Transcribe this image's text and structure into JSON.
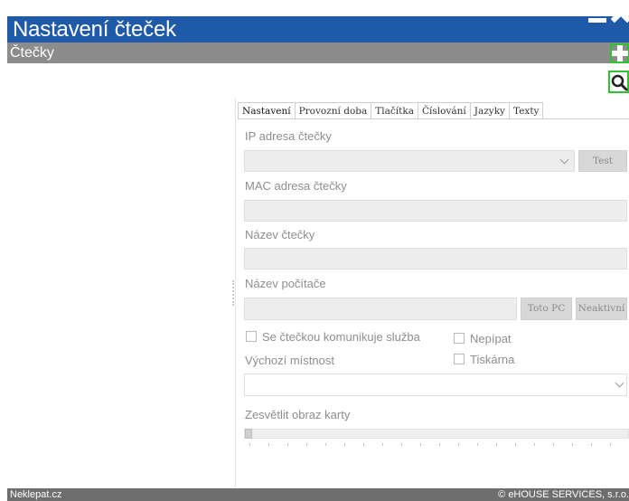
{
  "window": {
    "title": "Nastavení čteček",
    "minimize_icon": "minimize-icon",
    "close_icon": "close-icon"
  },
  "section": {
    "label": "Čtečky",
    "add_icon": "plus-icon",
    "search_icon": "search-icon"
  },
  "tabs": [
    {
      "label": "Nastavení",
      "active": true
    },
    {
      "label": "Provozní doba",
      "active": false
    },
    {
      "label": "Tlačítka",
      "active": false
    },
    {
      "label": "Číslování",
      "active": false
    },
    {
      "label": "Jazyky",
      "active": false
    },
    {
      "label": "Texty",
      "active": false
    }
  ],
  "form": {
    "ip_label": "IP adresa čtečky",
    "ip_value": "",
    "test_button": "Test",
    "mac_label": "MAC adresa čtečky",
    "mac_value": "",
    "name_label": "Název čtečky",
    "name_value": "",
    "pc_label": "Název počítače",
    "pc_value": "",
    "this_pc_button": "Toto PC",
    "inactive_button": "Neaktivní",
    "service_checkbox": {
      "label": "Se čtečkou komunikuje služba",
      "checked": false
    },
    "nepipat_checkbox": {
      "label": "Nepípat",
      "checked": false
    },
    "printer_checkbox": {
      "label": "Tiskárna",
      "checked": false
    },
    "default_room_label": "Výchozí místnost",
    "default_room_value": "",
    "brighten_label": "Zesvětlit obraz karty",
    "brighten_value": 0
  },
  "footer": {
    "left": "Neklepat.cz",
    "right": "© eHOUSE SERVICES, s.r.o."
  },
  "colors": {
    "titlebar": "#1e5aa8",
    "sectionbar": "#8c8c8c",
    "highlight": "#2dc52d",
    "footer": "#6e6e6e"
  }
}
